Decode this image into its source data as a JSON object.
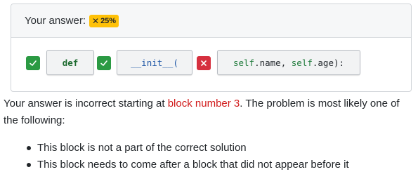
{
  "card": {
    "header_label": "Your answer:",
    "score_icon": "✕",
    "score_text": "25%",
    "status_colors": {
      "ok": "#2b9a43",
      "bad": "#d6303f",
      "badge": "#ffc107"
    }
  },
  "blocks": [
    {
      "status": "correct",
      "mark_icon": "check-icon",
      "code": "def"
    },
    {
      "status": "correct",
      "mark_icon": "check-icon",
      "code": "__init__("
    },
    {
      "status": "incorrect",
      "mark_icon": "close-icon",
      "code_parts": [
        "self",
        ".name, ",
        "self",
        ".age):"
      ]
    }
  ],
  "feedback": {
    "prefix": "Your answer is incorrect starting at ",
    "highlight": "block number 3",
    "suffix": ". The problem is most likely one of the following:",
    "reasons": [
      "This block is not a part of the correct solution",
      "This block needs to come after a block that did not appear before it"
    ]
  }
}
